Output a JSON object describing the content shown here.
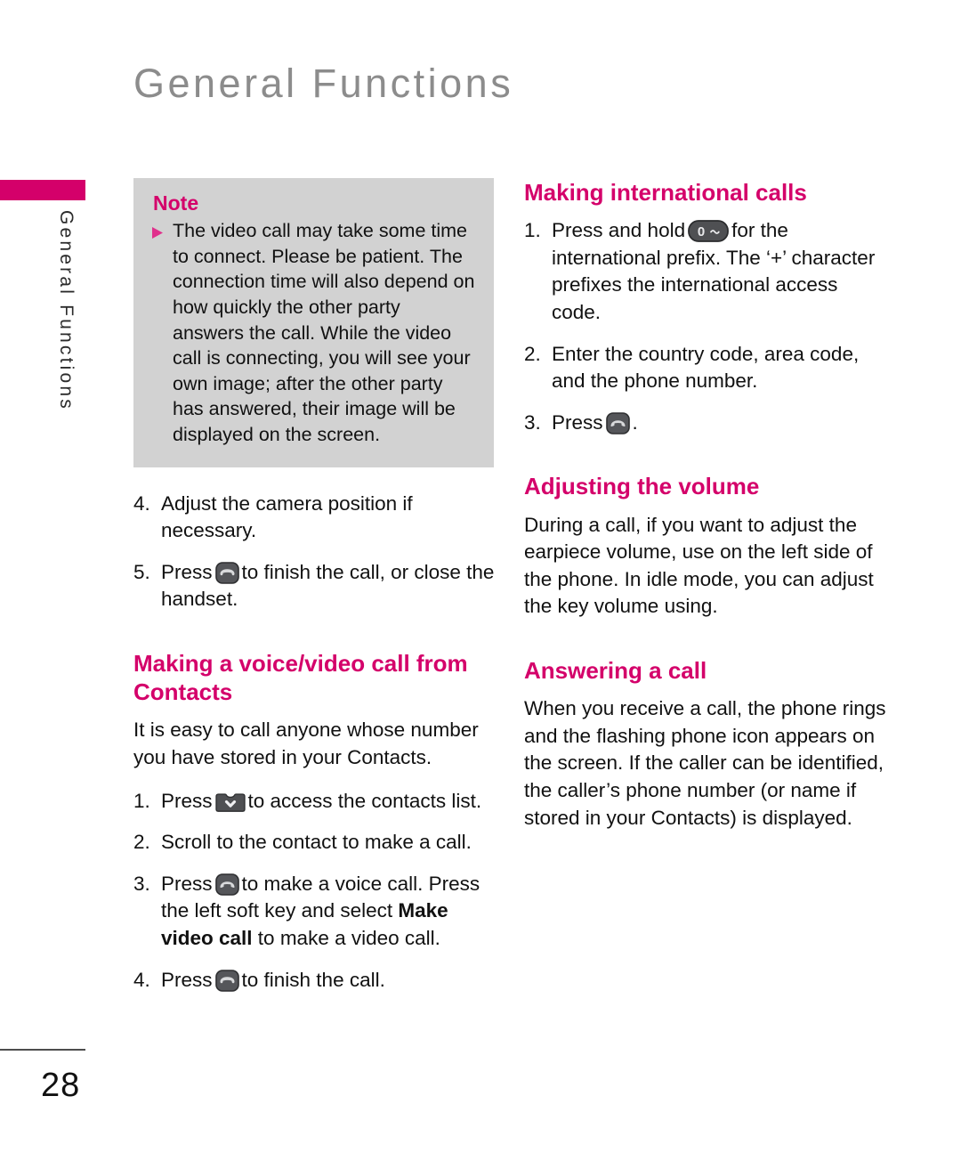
{
  "page": {
    "title": "General Functions",
    "side_label": "General Functions",
    "number": "28"
  },
  "note": {
    "heading": "Note",
    "bullet_icon": "triangle-right-icon",
    "text": "The video call may take some time to connect. Please be patient. The connection time will also depend on how quickly the other party answers the call. While the video call is connecting, you will see your own image; after the other party has answered, their image will be displayed on the screen."
  },
  "left_column": {
    "steps_continued": [
      {
        "num": "4.",
        "text": "Adjust the camera position if necessary."
      },
      {
        "num": "5.",
        "pre": "Press",
        "icon": "end-call-key-icon",
        "post": "to finish the call, or close the handset."
      }
    ],
    "heading": "Making a voice/video call from Contacts",
    "intro": "It is easy to call anyone whose number you have stored in your Contacts.",
    "steps": [
      {
        "num": "1.",
        "pre": "Press",
        "icon": "contacts-key-icon",
        "post": "to access the contacts list."
      },
      {
        "num": "2.",
        "text": "Scroll to the contact to make a call."
      },
      {
        "num": "3.",
        "pre": "Press",
        "icon": "send-call-key-icon",
        "mid": "to make a voice call. Press the left soft key and select ",
        "bold": "Make video call",
        "post": " to make a video call."
      },
      {
        "num": "4.",
        "pre": "Press",
        "icon": "end-call-key-icon",
        "post": "to finish the call."
      }
    ]
  },
  "right_column": {
    "heading_international": "Making international calls",
    "steps_international": [
      {
        "num": "1.",
        "pre": "Press and hold",
        "icon": "zero-key-icon",
        "post": "for the international prefix. The ‘+’ character prefixes the international access code."
      },
      {
        "num": "2.",
        "text": "Enter the country code, area code, and the phone number."
      },
      {
        "num": "3.",
        "pre": "Press",
        "icon": "send-call-key-icon",
        "post": "."
      }
    ],
    "heading_volume": "Adjusting the volume",
    "volume_text": "During a call, if you want to adjust the earpiece volume, use on the left side of the phone. In idle mode, you can adjust the key volume using.",
    "heading_answering": "Answering a call",
    "answering_text": "When you receive a call, the phone rings and the flashing phone icon appears on the screen. If the caller can be identified, the caller’s phone number (or name if stored in your Contacts) is displayed."
  },
  "colors": {
    "accent_magenta": "#d4006a",
    "note_background": "#d2d2d2",
    "title_gray": "#8c8c8c",
    "body_text": "#111111"
  }
}
